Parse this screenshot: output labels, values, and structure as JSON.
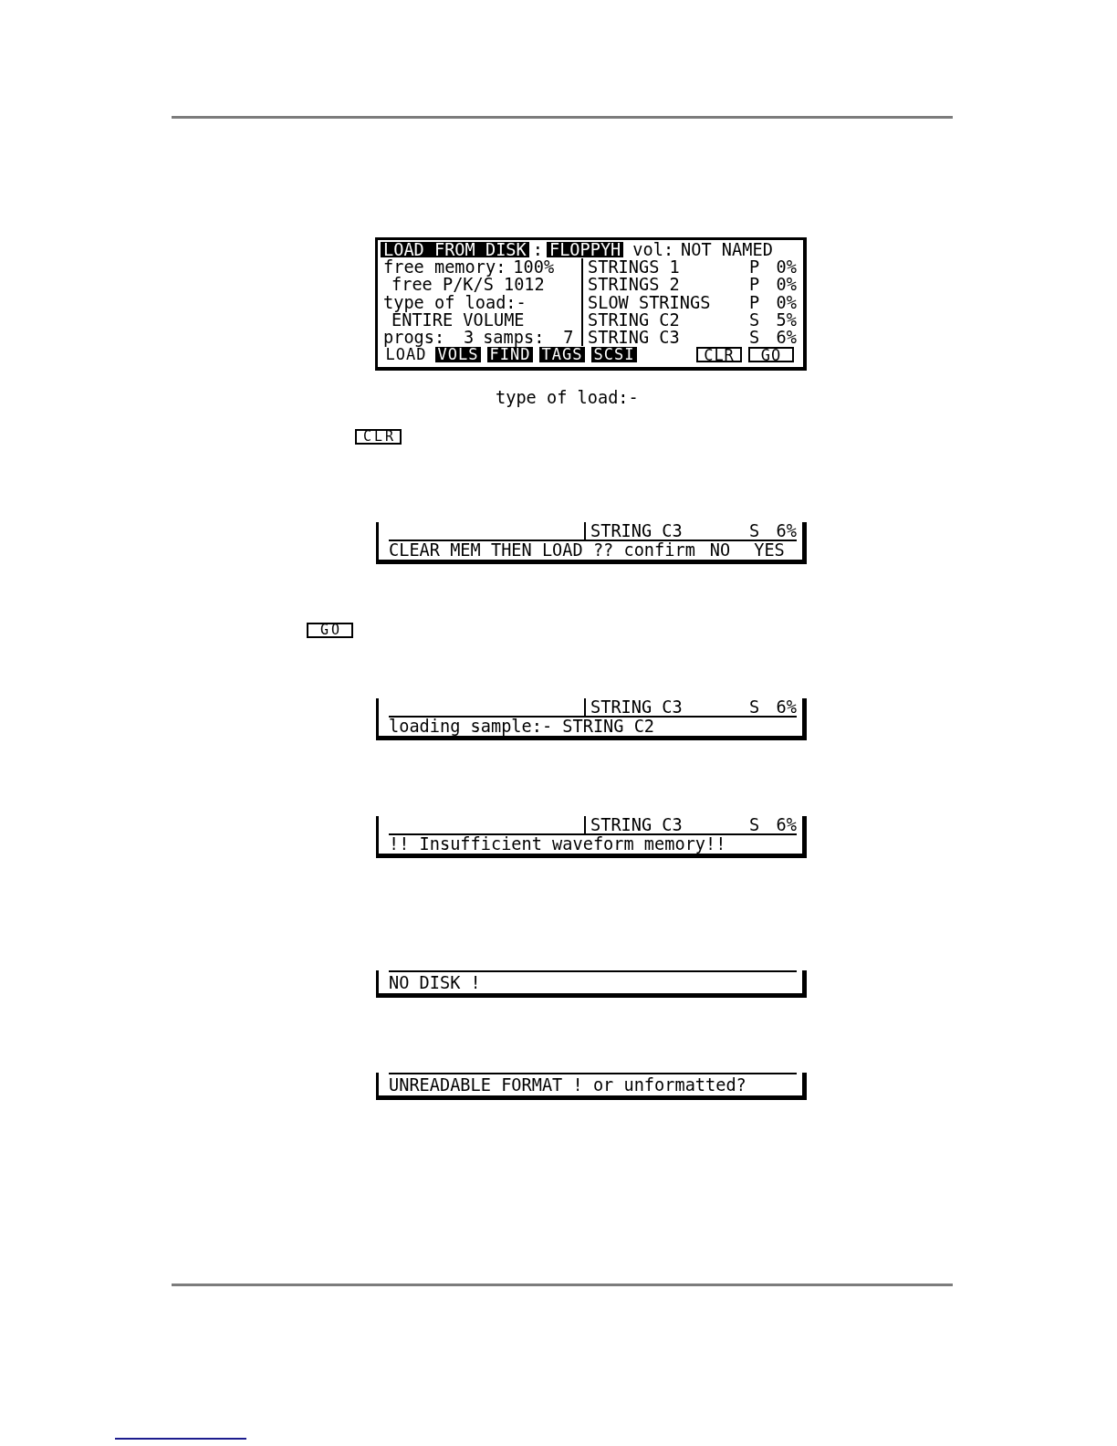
{
  "figures": [
    {
      "kind": "main_display",
      "header": {
        "title": "LOAD FROM DISK",
        "separator": ":",
        "device": "FLOPPYH",
        "volume_label": "vol:",
        "volume": "NOT NAMED"
      },
      "memory": {
        "label": "free memory:",
        "value": "100%"
      },
      "slots": {
        "label": "free P/K/S",
        "value": "1012"
      },
      "load_type": {
        "label": "type of load:-",
        "value": "ENTIRE VOLUME"
      },
      "counts": [
        {
          "label": "progs:",
          "value": "3"
        },
        {
          "label": "samps:",
          "value": "7"
        }
      ],
      "items": [
        {
          "name": "STRINGS 1",
          "category": "P",
          "size": "0%"
        },
        {
          "name": "STRINGS 2",
          "category": "P",
          "size": "0%"
        },
        {
          "name": "SLOW STRINGS",
          "category": "P",
          "size": "0%"
        },
        {
          "name": "STRING C2",
          "category": "S",
          "size": "5%"
        },
        {
          "name": "STRING C3",
          "category": "S",
          "size": "6%"
        }
      ],
      "soft_keys": [
        {
          "kind": "tab",
          "label": "LOAD",
          "selected": true
        },
        {
          "kind": "tab",
          "label": "VOLS",
          "selected": false
        },
        {
          "kind": "tab",
          "label": "FIND",
          "selected": false
        },
        {
          "kind": "tab",
          "label": "TAGS",
          "selected": false
        },
        {
          "kind": "tab",
          "label": "SCSI",
          "selected": false
        },
        {
          "kind": "action",
          "label": "CLR"
        },
        {
          "kind": "action",
          "label": "GO"
        }
      ]
    },
    {
      "kind": "caption",
      "text": "type of load:-"
    },
    {
      "kind": "key",
      "label": "CLR"
    },
    {
      "kind": "status_display",
      "top_row": {
        "name": "STRING C3",
        "category": "S",
        "size": "6%"
      },
      "message": "CLEAR MEM THEN LOAD ?? confirm",
      "options": [
        "NO",
        "YES"
      ]
    },
    {
      "kind": "key",
      "label": "GO"
    },
    {
      "kind": "status_display",
      "top_row": {
        "name": "STRING C3",
        "category": "S",
        "size": "6%"
      },
      "message": "loading sample:- STRING C2"
    },
    {
      "kind": "status_display",
      "top_row": {
        "name": "STRING C3",
        "category": "S",
        "size": "6%"
      },
      "message": "!! Insufficient waveform memory!!"
    },
    {
      "kind": "message_display",
      "message": "NO DISK !"
    },
    {
      "kind": "message_display",
      "message": "UNREADABLE FORMAT ! or unformatted?"
    }
  ]
}
